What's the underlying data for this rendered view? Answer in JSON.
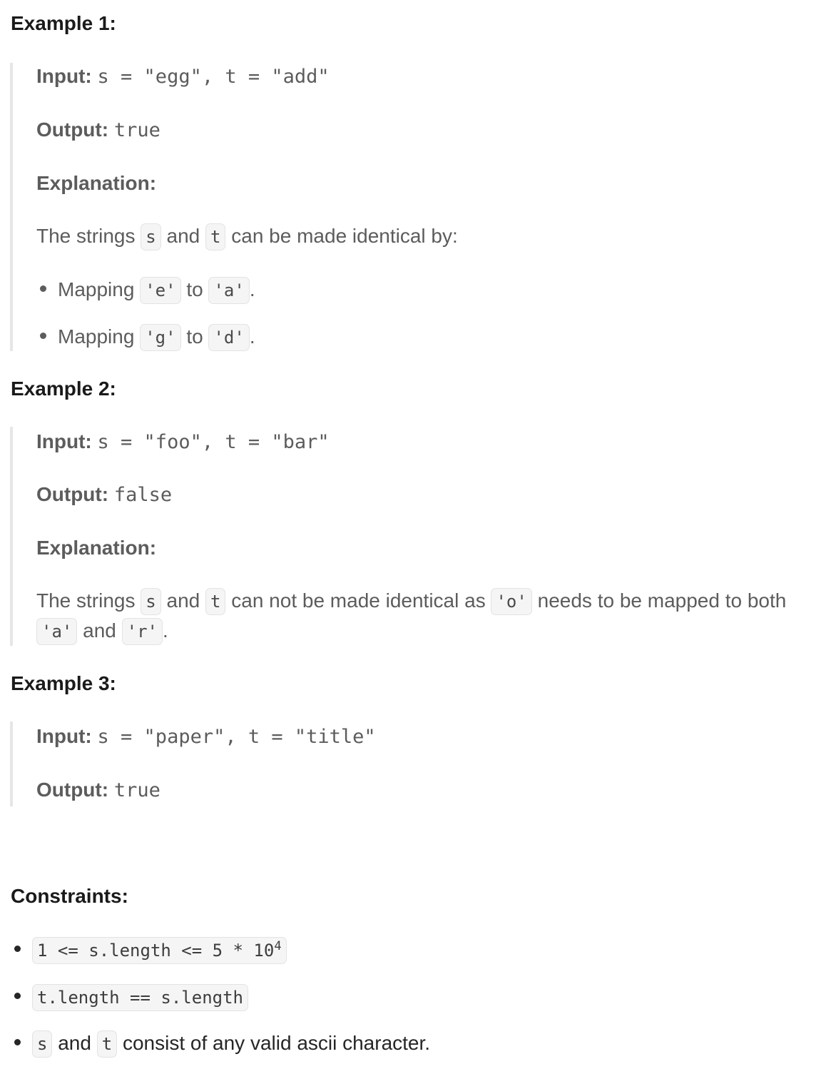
{
  "examples": [
    {
      "heading": "Example 1:",
      "input_label": "Input:",
      "input_value": "s = \"egg\", t = \"add\"",
      "output_label": "Output:",
      "output_value": "true",
      "explanation_label": "Explanation:",
      "explanation": {
        "p1": "The strings",
        "c1": "s",
        "p2": "and",
        "c2": "t",
        "p3": "can be made identical by:"
      },
      "bullets": [
        {
          "pre": "Mapping",
          "a": "'e'",
          "mid": "to",
          "b": "'a'",
          "post": "."
        },
        {
          "pre": "Mapping",
          "a": "'g'",
          "mid": "to",
          "b": "'d'",
          "post": "."
        }
      ]
    },
    {
      "heading": "Example 2:",
      "input_label": "Input:",
      "input_value": "s = \"foo\", t = \"bar\"",
      "output_label": "Output:",
      "output_value": "false",
      "explanation_label": "Explanation:",
      "explanation": {
        "p1": "The strings",
        "c1": "s",
        "p2": "and",
        "c2": "t",
        "p3": "can not be made identical as",
        "c3": "'o'",
        "p4": "needs to be mapped to both",
        "c4": "'a'",
        "p5": "and",
        "c5": "'r'",
        "p6": "."
      }
    },
    {
      "heading": "Example 3:",
      "input_label": "Input:",
      "input_value": "s = \"paper\", t = \"title\"",
      "output_label": "Output:",
      "output_value": "true"
    }
  ],
  "constraints": {
    "heading": "Constraints:",
    "items": [
      {
        "code": "1 <= s.length <= 5 * 10",
        "sup": "4"
      },
      {
        "code": "t.length == s.length"
      },
      {
        "c1": "s",
        "p1": "and",
        "c2": "t",
        "p2": "consist of any valid ascii character."
      }
    ]
  }
}
